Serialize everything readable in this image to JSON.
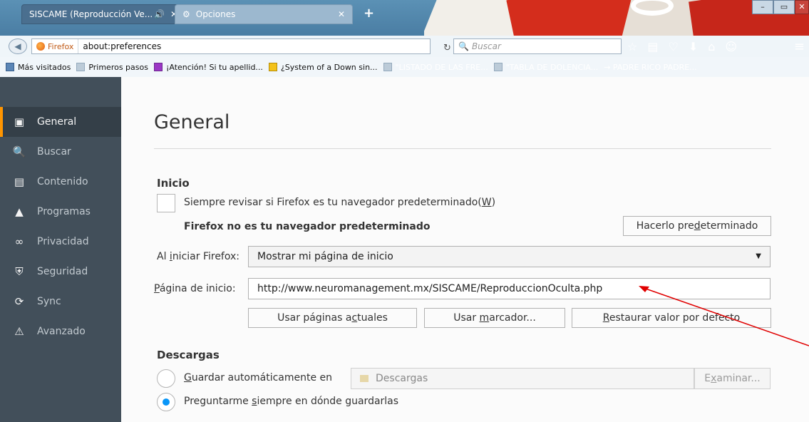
{
  "tabs": [
    {
      "label": "SISCAME (Reproducción Ve...",
      "audio_icon": "speaker-icon"
    },
    {
      "label": "Opciones",
      "icon": "gear-icon"
    }
  ],
  "window_buttons": {
    "minimize": "–",
    "maximize": "▭",
    "close": "✕"
  },
  "nav": {
    "identity": "Firefox",
    "url": "about:preferences",
    "search_placeholder": "Buscar"
  },
  "bookmarks": [
    "Más visitados",
    "Primeros pasos",
    "¡Atención! Si tu apellid...",
    "¿System of a Down sin...",
    "\"LISTADO DE LAS FRE...",
    "\"TABLA DE DOLENCIA...",
    "→ PADRE RICO PADRE..."
  ],
  "sidebar": {
    "items": [
      {
        "label": "General",
        "icon": "general-icon"
      },
      {
        "label": "Buscar",
        "icon": "search-icon"
      },
      {
        "label": "Contenido",
        "icon": "content-icon"
      },
      {
        "label": "Programas",
        "icon": "applications-icon"
      },
      {
        "label": "Privacidad",
        "icon": "privacy-mask-icon"
      },
      {
        "label": "Seguridad",
        "icon": "security-icon"
      },
      {
        "label": "Sync",
        "icon": "sync-icon"
      },
      {
        "label": "Avanzado",
        "icon": "advanced-icon"
      }
    ]
  },
  "main": {
    "title": "General",
    "startup": {
      "heading": "Inicio",
      "default_check_pre": "Siempre revisar si Firefox es tu navegador predeterminado(",
      "default_check_key": "W",
      "default_check_post": ")",
      "not_default": "Firefox no es tu navegador predeterminado",
      "make_default_pre": "Hacerlo pre",
      "make_default_key": "d",
      "make_default_post": "eterminado",
      "on_start_pre": "Al ",
      "on_start_key": "i",
      "on_start_post": "niciar Firefox:",
      "on_start_value": "Mostrar mi página de inicio",
      "homepage_pre": "",
      "homepage_key": "P",
      "homepage_post": "ágina de inicio:",
      "homepage_value": "http://www.neuromanagement.mx/SISCAME/ReproduccionOculta.php",
      "btn_current_pre": "Usar páginas a",
      "btn_current_key": "c",
      "btn_current_post": "tuales",
      "btn_bookmark_pre": "Usar ",
      "btn_bookmark_key": "m",
      "btn_bookmark_post": "arcador...",
      "btn_restore_pre": "",
      "btn_restore_key": "R",
      "btn_restore_post": "estaurar valor por defecto"
    },
    "downloads": {
      "heading": "Descargas",
      "auto_save_pre": "",
      "auto_save_key": "G",
      "auto_save_post": "uardar automáticamente en",
      "folder": "Descargas",
      "browse_pre": "E",
      "browse_key": "x",
      "browse_post": "aminar...",
      "always_ask_pre": "Preguntarme ",
      "always_ask_key": "s",
      "always_ask_post": "iempre en dónde guardarlas"
    }
  },
  "colors": {
    "sidebar_bg": "#424f5a",
    "sidebar_active_accent": "#ff9500",
    "radio_selected": "#0996f8",
    "annotation_arrow": "#e00000"
  }
}
